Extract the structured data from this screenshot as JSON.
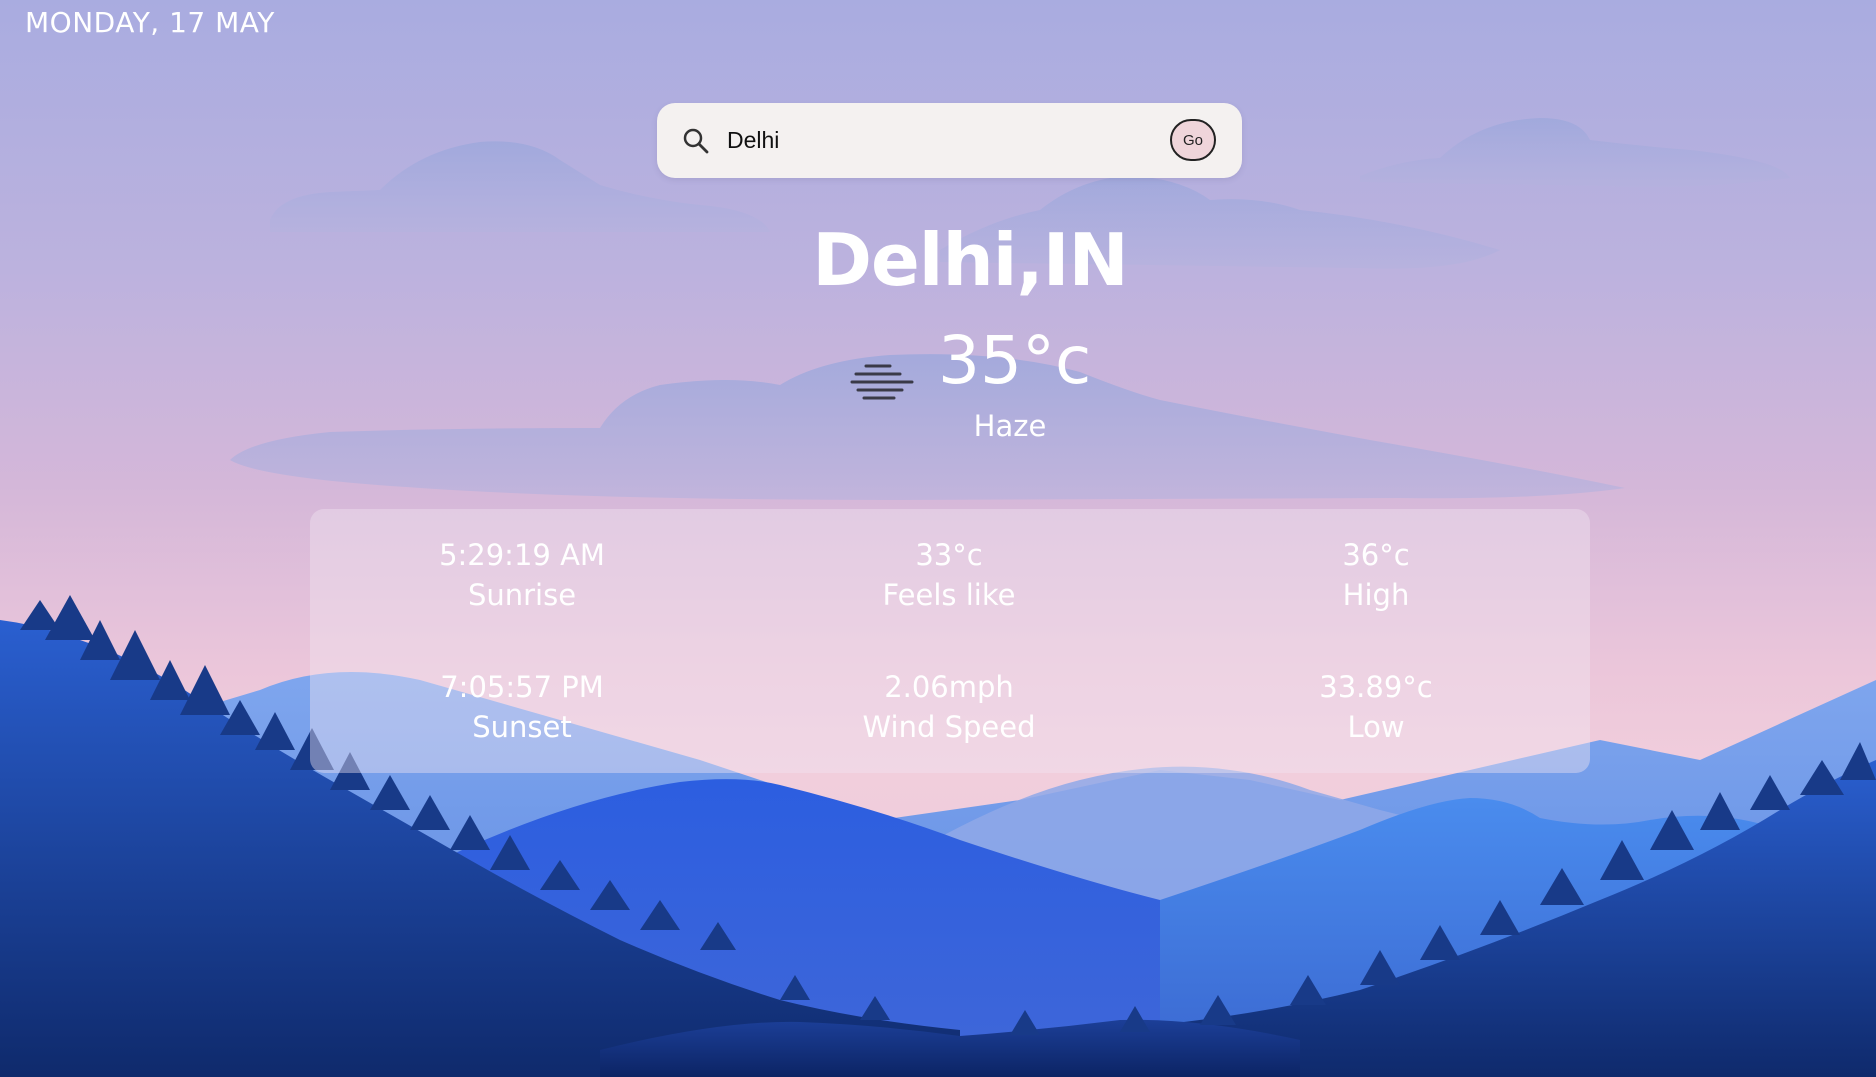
{
  "header": {
    "date": "MONDAY, 17 MAY"
  },
  "search": {
    "value": "Delhi",
    "button_label": "Go"
  },
  "current": {
    "location": "Delhi,IN",
    "temperature": "35°c",
    "condition": "Haze",
    "icon": "haze-icon"
  },
  "details": {
    "sunrise": {
      "value": "5:29:19 AM",
      "label": "Sunrise"
    },
    "feels_like": {
      "value": "33°c",
      "label": "Feels like"
    },
    "high": {
      "value": "36°c",
      "label": "High"
    },
    "sunset": {
      "value": "7:05:57 PM",
      "label": "Sunset"
    },
    "wind_speed": {
      "value": "2.06mph",
      "label": "Wind Speed"
    },
    "low": {
      "value": "33.89°c",
      "label": "Low"
    }
  },
  "colors": {
    "sky_top": "#a9ace0",
    "sky_bottom": "#f1cedc",
    "mountain_dark": "#163a8c",
    "mountain_mid": "#2f5ad6",
    "search_background": "#f4f1f0",
    "go_button": "#efd5da",
    "text": "#ffffff"
  }
}
